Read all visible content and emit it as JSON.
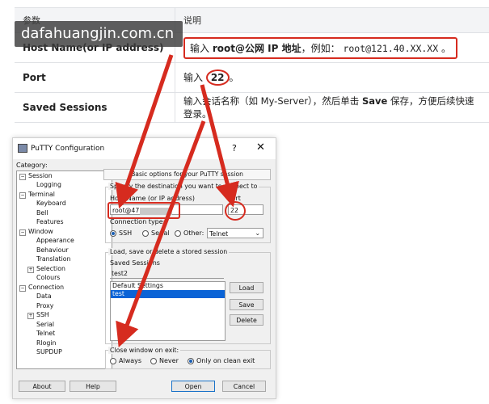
{
  "watermark": "dafahuangjin.com.cn",
  "table": {
    "header": {
      "col1": "参数",
      "col2": "说明"
    },
    "rows": [
      {
        "param": "Host Name(or IP address)",
        "desc_prefix": "输入 ",
        "desc_bold": "root@公网 IP 地址",
        "desc_mid": "，例如：",
        "desc_code": "root@121.40.XX.XX",
        "desc_suffix": " 。"
      },
      {
        "param": "Port",
        "desc_prefix": "输入 ",
        "desc_value": "22",
        "desc_suffix": "。"
      },
      {
        "param": "Saved Sessions",
        "desc_prefix": "输入会话名称（如 My-Server），然后单击 ",
        "desc_bold": "Save",
        "desc_suffix": " 保存，方便后续快速登录。"
      }
    ]
  },
  "putty": {
    "title": "PuTTY Configuration",
    "help": "?",
    "close": "✕",
    "category_label": "Category:",
    "tree": [
      {
        "label": "Session",
        "toggle": "−"
      },
      {
        "label": "Logging"
      },
      {
        "label": "Terminal",
        "toggle": "−"
      },
      {
        "label": "Keyboard"
      },
      {
        "label": "Bell"
      },
      {
        "label": "Features"
      },
      {
        "label": "Window",
        "toggle": "−"
      },
      {
        "label": "Appearance"
      },
      {
        "label": "Behaviour"
      },
      {
        "label": "Translation"
      },
      {
        "label": "Selection",
        "toggle": "+"
      },
      {
        "label": "Colours"
      },
      {
        "label": "Connection",
        "toggle": "−"
      },
      {
        "label": "Data"
      },
      {
        "label": "Proxy"
      },
      {
        "label": "SSH",
        "toggle": "+"
      },
      {
        "label": "Serial"
      },
      {
        "label": "Telnet"
      },
      {
        "label": "Rlogin"
      },
      {
        "label": "SUPDUP"
      }
    ],
    "banner": "Basic options for your PuTTY session",
    "dest_group": "Specify the destination you want to connect to",
    "host_label": "Host Name (or IP address)",
    "host_value": "root@47",
    "port_label": "Port",
    "port_value": "22",
    "conn_type_label": "Connection type:",
    "conn_types": [
      "SSH",
      "Serial",
      "Other:"
    ],
    "other_select": "Telnet",
    "dropdown_glyph": "⌄",
    "load_group": "Load, save or delete a stored session",
    "saved_label": "Saved Sessions",
    "saved_input": "test2",
    "sessions": [
      "Default Settings",
      "test"
    ],
    "load_btn": "Load",
    "save_btn": "Save",
    "delete_btn": "Delete",
    "close_exit_label": "Close window on exit:",
    "exit_options": [
      "Always",
      "Never",
      "Only on clean exit"
    ],
    "about_btn": "About",
    "help_btn": "Help",
    "open_btn": "Open",
    "cancel_btn": "Cancel"
  },
  "colors": {
    "highlight": "#d62b1f",
    "selection": "#0a63d6"
  }
}
